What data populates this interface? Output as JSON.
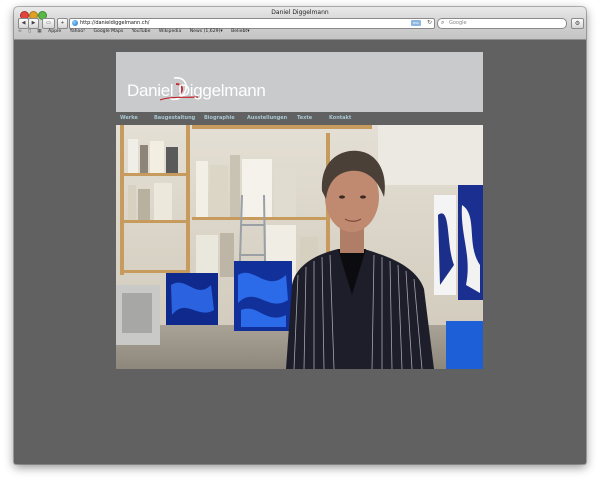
{
  "browser": {
    "window_title": "Daniel Diggelmann",
    "url": "http://danieldiggelmann.ch/",
    "rss_label": "RSS",
    "search_placeholder": "Google",
    "bookmarks": [
      "Apple",
      "Yahoo!",
      "Google Maps",
      "YouTube",
      "Wikipedia",
      "News (1,629)▾",
      "Beliebt▾"
    ]
  },
  "site": {
    "logo_text": "Daniel Diggelmann",
    "menu": [
      "Werke",
      "Baugestaltung",
      "Biographie",
      "Ausstellungen",
      "Texte",
      "Kontakt"
    ]
  },
  "colors": {
    "page_background": "#616161",
    "header_background": "#c8cacb",
    "menu_text": "#a9c8d2",
    "logo_accent": "#c0262d"
  }
}
